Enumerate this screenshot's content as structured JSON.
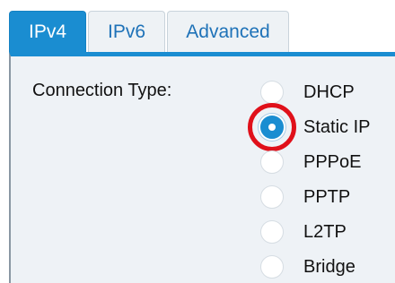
{
  "tabs": [
    {
      "label": "IPv4",
      "active": true
    },
    {
      "label": "IPv6",
      "active": false
    },
    {
      "label": "Advanced",
      "active": false
    }
  ],
  "connection_type": {
    "label": "Connection Type:",
    "options": [
      {
        "label": "DHCP",
        "selected": false
      },
      {
        "label": "Static IP",
        "selected": true,
        "highlighted": true
      },
      {
        "label": "PPPoE",
        "selected": false
      },
      {
        "label": "PPTP",
        "selected": false
      },
      {
        "label": "L2TP",
        "selected": false
      },
      {
        "label": "Bridge",
        "selected": false
      }
    ]
  },
  "colors": {
    "accent": "#1a8dd1",
    "highlight_ring": "#e0101a",
    "panel_background": "#eef2f6"
  }
}
